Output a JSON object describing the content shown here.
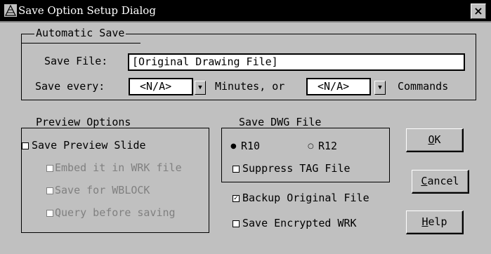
{
  "window": {
    "title": "Save Option Setup Dialog",
    "close_label": "×"
  },
  "automatic_save": {
    "group_label": "Automatic Save",
    "save_file_label": "Save File:",
    "save_file_value": "[Original Drawing File]",
    "save_every_label": "Save every:",
    "minutes_value": "<N/A>",
    "minutes_suffix": "Minutes, or",
    "commands_value": "<N/A>",
    "commands_suffix": "Commands"
  },
  "preview_options": {
    "group_label": "Preview Options",
    "save_preview_slide": {
      "label": "Save Preview Slide",
      "checked": false
    },
    "embed_in_wrk": {
      "label": "Embed it in WRK file",
      "checked": false,
      "disabled": true
    },
    "save_for_wblock": {
      "label": "Save for WBLOCK",
      "checked": false,
      "disabled": true
    },
    "query_before_saving": {
      "label": "Query before saving",
      "checked": false,
      "disabled": true
    }
  },
  "save_dwg_file": {
    "group_label": "Save DWG File",
    "r10": {
      "label": "R10",
      "selected": true
    },
    "r12": {
      "label": "R12",
      "selected": false
    },
    "suppress_tag": {
      "label": "Suppress TAG File",
      "checked": false
    }
  },
  "backup_original": {
    "label": "Backup Original File",
    "checked": true
  },
  "save_encrypted": {
    "label": "Save Encrypted WRK",
    "checked": false
  },
  "buttons": {
    "ok": {
      "mnemonic": "O",
      "rest": "K"
    },
    "cancel": {
      "mnemonic": "C",
      "rest": "ancel"
    },
    "help": {
      "mnemonic": "H",
      "rest": "elp"
    }
  },
  "icons": {
    "app": "dialog-app-icon",
    "dropdown": "dropdown-arrow-icon"
  }
}
